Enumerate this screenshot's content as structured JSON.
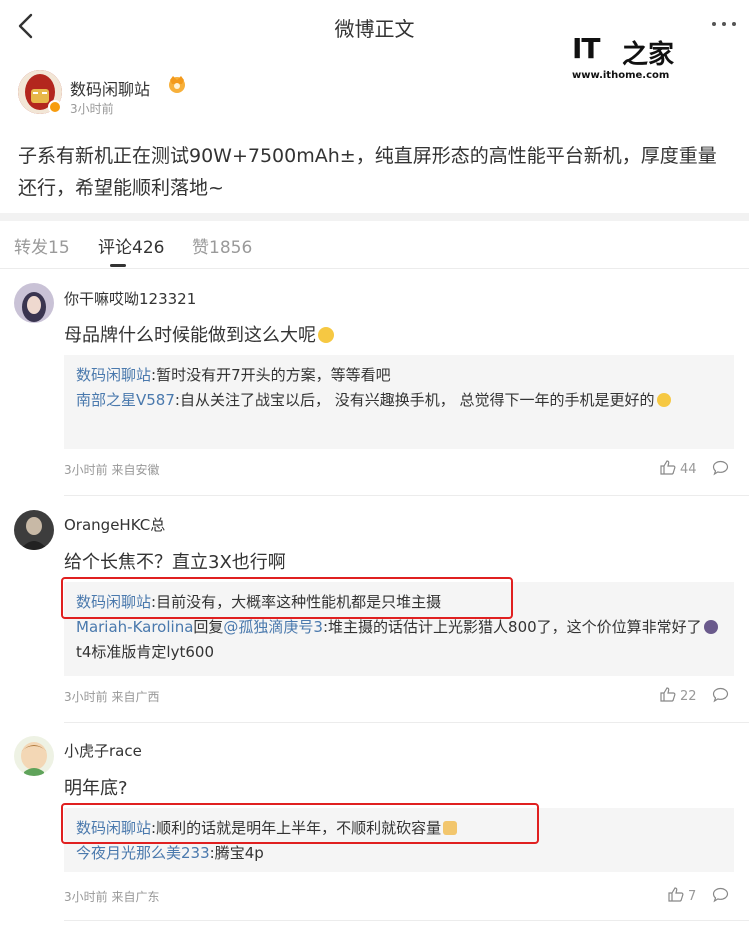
{
  "nav": {
    "title": "微博正文"
  },
  "watermark": {
    "brand": "IT",
    "brand_zh": "之家",
    "url": "www.ithome.com"
  },
  "post": {
    "author": "数码闲聊站",
    "time": "3小时前",
    "text": "子系有新机正在测试90W+7500mAh±，纯直屏形态的高性能平台新机，厚度重量还行，希望能顺利落地~"
  },
  "tabs": [
    {
      "label": "转发15"
    },
    {
      "label": "评论426"
    },
    {
      "label": "赞1856"
    }
  ],
  "comments": [
    {
      "user": "你干嘛哎呦123321",
      "text": "母品牌什么时候能做到这么大呢",
      "replies": [
        {
          "user": "数码闲聊站",
          "text": ":暂时没有开7开头的方案，等等看吧"
        },
        {
          "user": "南部之星V587",
          "text": ":自从关注了战宝以后， 没有兴趣换手机， 总觉得下一年的手机是更好的"
        }
      ],
      "meta": "3小时前 来自安徽",
      "likes": "44"
    },
    {
      "user": "OrangeHKC总",
      "text": "给个长焦不？直立3X也行啊",
      "replies": [
        {
          "user": "数码闲聊站",
          "text": ":目前没有，大概率这种性能机都是只堆主摄"
        },
        {
          "user": "Mariah-Karolina",
          "mid": "回复",
          "mention": "@孤独滴庚号3",
          "text": ":堆主摄的话估计上光影猎人800了，这个价位算非常好了",
          "tail": "t4标准版肯定lyt600"
        }
      ],
      "meta": "3小时前 来自广西",
      "likes": "22"
    },
    {
      "user": "小虎子race",
      "text": "明年底?",
      "replies": [
        {
          "user": "数码闲聊站",
          "text": ":顺利的话就是明年上半年，不顺利就砍容量"
        },
        {
          "user": "今夜月光那么美233",
          "text": ":腾宝4p"
        }
      ],
      "meta": "3小时前 来自广东",
      "likes": "7"
    }
  ],
  "icons": {
    "back": "back-arrow-icon",
    "more": "more-dots-icon",
    "like": "thumbs-up-icon",
    "reply": "comment-bubble-icon"
  },
  "colors": {
    "link": "#4a79ad",
    "highlight_box": "#e02020",
    "reply_bg": "#f5f5f5"
  }
}
